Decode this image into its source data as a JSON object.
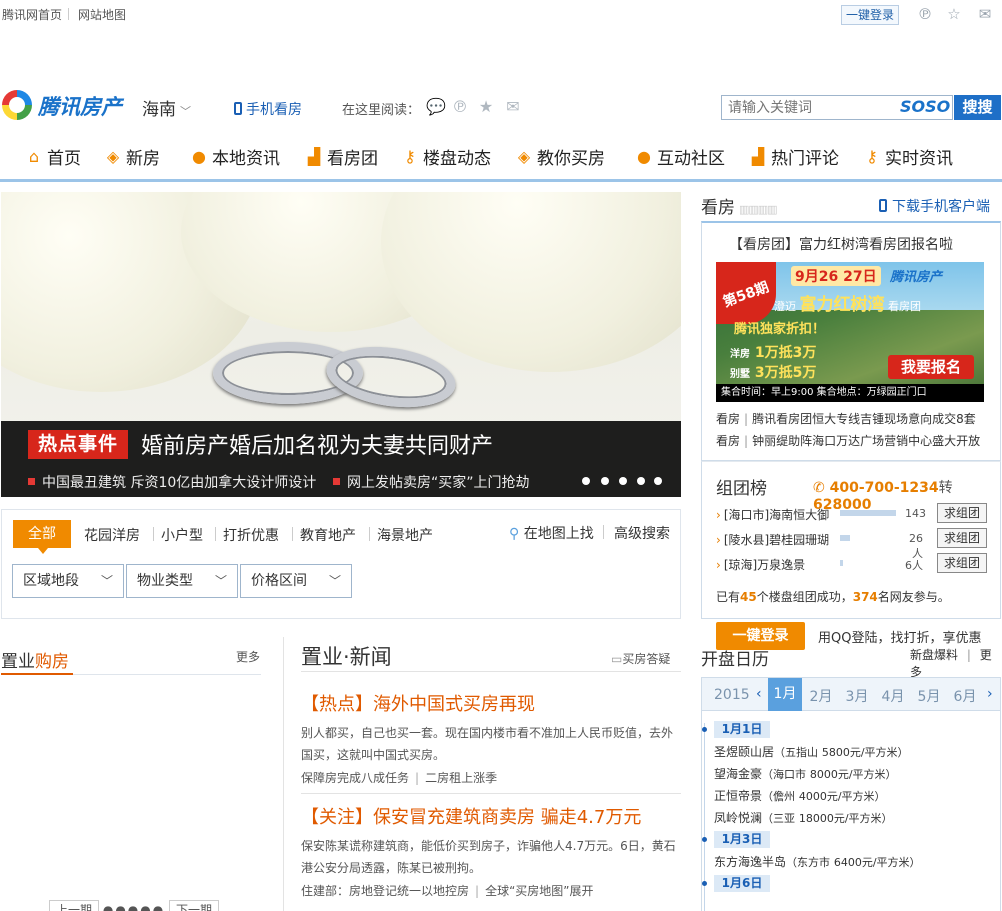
{
  "topbar": {
    "home": "腾讯网首页",
    "sitemap": "网站地图",
    "login": "一键登录"
  },
  "header": {
    "logo_text": "腾讯房产",
    "city": "海南",
    "mobile_view": "手机看房",
    "read_here": "在这里阅读：",
    "search_placeholder": "请输入关键词",
    "soso": "SOSO",
    "search_button": "搜搜"
  },
  "nav": {
    "items": [
      "首页",
      "新房",
      "本地资讯",
      "看房团",
      "楼盘动态",
      "教你买房",
      "互动社区",
      "热门评论",
      "实时资讯"
    ]
  },
  "hero": {
    "tag": "热点事件",
    "title": "婚前房产婚后加名视为夫妻共同财产",
    "sub1": "中国最丑建筑 斥资10亿由加拿大设计师设计",
    "sub2": "网上发帖卖房“买家”上门抢劫"
  },
  "filter": {
    "active_tab": "全部",
    "tabs": [
      "花园洋房",
      "小户型",
      "打折优惠",
      "教育地产",
      "海景地产"
    ],
    "map_search": "在地图上找",
    "adv_search": "高级搜索",
    "selects": [
      "区域地段",
      "物业类型",
      "价格区间"
    ]
  },
  "kanfang": {
    "title": "看房",
    "download": "下载手机客户端",
    "headline": "【看房团】富力红树湾看房团报名啦",
    "banner": {
      "issue": "第58期",
      "date": "9月26 27日",
      "logo": "腾讯房产",
      "region": "澄迈",
      "project": "富力红树湾",
      "suffix": "看房团",
      "discount": "腾讯独家折扣！",
      "line1_label": "洋房",
      "line1": "1万抵3万",
      "line2_label": "别墅",
      "line2": "3万抵5万",
      "signup": "我要报名",
      "footer": "集合时间：早上9:00    集合地点：万绿园正门口"
    },
    "links": [
      {
        "tag": "看房",
        "text": "腾讯看房团恒大专线吉锺现场意向成交8套"
      },
      {
        "tag": "看房",
        "text": "钟丽缇助阵海口万达广场营销中心盛大开放"
      }
    ]
  },
  "zutuan": {
    "title": "组团榜",
    "phone": "400-700-1234",
    "ext_label": "转",
    "ext": "628000",
    "button": "求组团",
    "rows": [
      {
        "name": "[海口市]海南恒大御",
        "count": "143",
        "level": 1.0
      },
      {
        "name": "[陵水县]碧桂园珊瑚",
        "count": "26人",
        "level": 0.18
      },
      {
        "name": "[琼海]万泉逸景",
        "count": "6人",
        "level": 0.05
      }
    ],
    "summary_pre": "已有",
    "summary_n1": "45",
    "summary_mid": "个楼盘组团成功，",
    "summary_n2": "374",
    "summary_post": "名网友参与。"
  },
  "login_panel": {
    "button": "一键登录",
    "text": "用QQ登陆，找打折，享优惠"
  },
  "kaipan": {
    "title": "开盘日历",
    "link1": "新盘爆料",
    "link2": "更多",
    "year": "2015",
    "months": [
      "1月",
      "2月",
      "3月",
      "4月",
      "5月",
      "6月"
    ],
    "active_month": "1月",
    "groups": [
      {
        "date": "1月1日",
        "items": [
          {
            "name": "圣煜颐山居",
            "city": "（五指山",
            "price": "5800元/平方米）"
          },
          {
            "name": "望海金豪",
            "city": "（海口市",
            "price": "8000元/平方米）"
          },
          {
            "name": "正恒帝景",
            "city": "（儋州",
            "price": "4000元/平方米）"
          },
          {
            "name": "凤岭悦澜",
            "city": "（三亚",
            "price": "18000元/平方米）"
          }
        ]
      },
      {
        "date": "1月3日",
        "items": [
          {
            "name": "东方海逸半岛",
            "city": "（东方市",
            "price": "6400元/平方米）"
          }
        ]
      },
      {
        "date": "1月6日",
        "items": []
      }
    ]
  },
  "buy": {
    "title_a": "置业",
    "title_b": "购房",
    "more": "更多",
    "prev": "上一期",
    "next": "下一期"
  },
  "news": {
    "title": "置业·新闻",
    "qa": "买房答疑",
    "articles": [
      {
        "headline": "【热点】海外中国式买房再现",
        "summary": "别人都买，自己也买一套。现在国内楼市看不准加上人民币贬值，去外国买，这就叫中国式买房。",
        "links": [
          "保障房完成八成任务",
          "二房租上涨季"
        ]
      },
      {
        "headline": "【关注】保安冒充建筑商卖房 骗走4.7万元",
        "summary": "保安陈某谎称建筑商，能低价买到房子，诈骗他人4.7万元。6日，黄石港公安分局透露，陈某已被刑拘。",
        "links": [
          "住建部：房地登记统一以地控房",
          "全球“买房地图”展开"
        ]
      }
    ]
  }
}
